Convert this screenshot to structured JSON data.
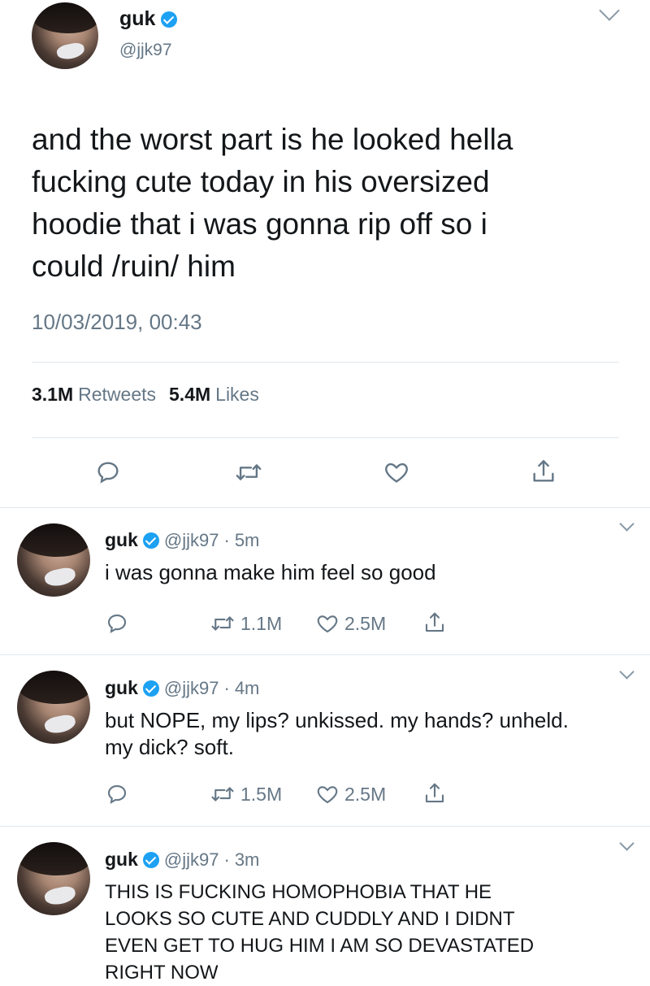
{
  "main_tweet": {
    "display_name": "guk",
    "handle": "@jjk97",
    "text_lines": [
      "and the worst part is he looked hella",
      "fucking cute today in his oversized",
      "hoodie that i was gonna rip off so i",
      "could /ruin/ him"
    ],
    "timestamp": "10/03/2019, 00:43",
    "retweets_count": "3.1M",
    "retweets_label": "Retweets",
    "likes_count": "5.4M",
    "likes_label": "Likes"
  },
  "replies": [
    {
      "display_name": "guk",
      "handle": "@jjk97",
      "separator": "·",
      "time": "5m",
      "text_lines": [
        "i was gonna make him feel so good"
      ],
      "retweets": "1.1M",
      "likes": "2.5M"
    },
    {
      "display_name": "guk",
      "handle": "@jjk97",
      "separator": "·",
      "time": "4m",
      "text_lines": [
        "but NOPE, my lips? unkissed. my hands? unheld.",
        "my dick? soft."
      ],
      "retweets": "1.5M",
      "likes": "2.5M"
    },
    {
      "display_name": "guk",
      "handle": "@jjk97",
      "separator": "·",
      "time": "3m",
      "text_lines": [
        "THIS IS FUCKING HOMOPHOBIA THAT HE",
        "LOOKS SO CUTE AND CUDDLY AND I DIDNT",
        "EVEN GET TO HUG HIM I AM SO DEVASTATED",
        "RIGHT NOW"
      ]
    }
  ],
  "colors": {
    "verified": "#1da1f2",
    "muted": "#657786",
    "divider": "#e1e8ed"
  }
}
